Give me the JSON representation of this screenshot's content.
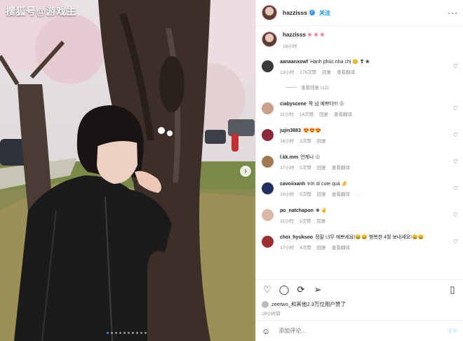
{
  "watermark": "搜狐号@游戏主",
  "post": {
    "username": "hazzisss",
    "follow_label": "关注",
    "more_icon": "more-icon",
    "caption_flowers": "❀ ❀ ❀",
    "caption_time": "18小时",
    "likes_text": "zeetwo_和其他2.3万位用户赞了",
    "post_time": "18小时前",
    "add_comment_placeholder": "添加评论...",
    "post_button": "发布"
  },
  "comments": [
    {
      "user": "aanaanxowf",
      "text": "Hạnh phúc nha chị 😊 ❣ ❀",
      "time": "13小时",
      "likes": "176次赞",
      "reply": "回复",
      "translate": "查看翻译",
      "avatar_color": "#3a3a3a"
    },
    {
      "user": "ciabyscene",
      "text": "짝 넘 예쁘다!!! ❀",
      "time": "11小时",
      "likes": "14次赞",
      "reply": "回复",
      "translate": "查看翻译",
      "avatar_color": "#caa08c"
    },
    {
      "user": "jujin3883",
      "text": "😍😍😍",
      "time": "18小时",
      "likes": "3次赞",
      "reply": "回复",
      "translate": "",
      "avatar_color": "#8a2a3a"
    },
    {
      "user": "l.kk.mm",
      "text": "언제나 ❀",
      "time": "17小时",
      "likes": "5次赞",
      "reply": "回复",
      "translate": "查看翻译",
      "avatar_color": "#a07a50"
    },
    {
      "user": "cavoiixanh",
      "text": "trời di cute quá 🤌",
      "time": "10小时",
      "likes": "5次赞",
      "reply": "回复",
      "translate": "查看翻译",
      "avatar_color": "#203060"
    },
    {
      "user": "po_natchapon",
      "text": "❀ ✌",
      "time": "11小时",
      "likes": "1次赞",
      "reply": "回复",
      "translate": "",
      "avatar_color": "#d8b8a8"
    },
    {
      "user": "choi_hyuksoo",
      "text": "정말 너무 예쁘세요!😄😄 행복한 4월 보내세요!😄😄",
      "time": "17小时",
      "likes": "4次赞",
      "reply": "回复",
      "translate": "查看翻译",
      "avatar_color": "#9a3030"
    }
  ],
  "view_replies": "查看回复 (12)",
  "actions": {
    "heart": "heart-icon",
    "comment": "comment-icon",
    "repost": "repost-icon",
    "share": "share-icon",
    "save": "bookmark-icon"
  },
  "carousel": {
    "total": 10,
    "active": 1
  },
  "colors": {
    "accent": "#0095f6",
    "flower": "#e2618c"
  }
}
